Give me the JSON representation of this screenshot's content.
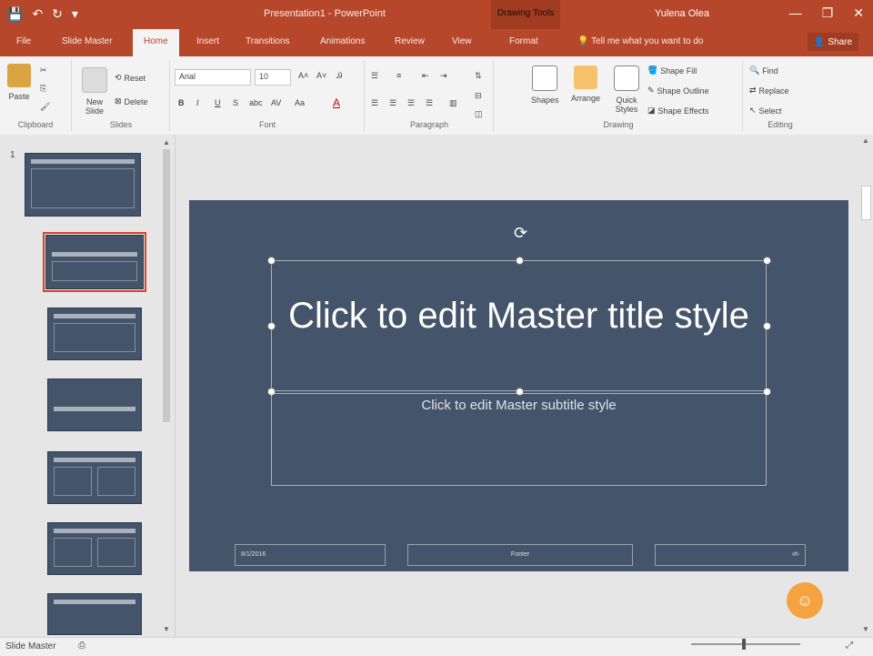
{
  "titlebar": {
    "doc_title": "Presentation1 - PowerPoint",
    "context_group": "Drawing Tools",
    "user": "Yulena Olea",
    "qat": {
      "save": "💾",
      "undo": "↶",
      "redo": "↻",
      "customize": "▾"
    },
    "window": {
      "minimize": "—",
      "restore": "❐",
      "close": "✕"
    }
  },
  "tabs": [
    {
      "label": "File"
    },
    {
      "label": "Slide Master"
    },
    {
      "label": "Home"
    },
    {
      "label": "Insert"
    },
    {
      "label": "Transitions"
    },
    {
      "label": "Animations"
    },
    {
      "label": "Review"
    },
    {
      "label": "View"
    },
    {
      "label": "Format"
    }
  ],
  "tellme": "Tell me what you want to do",
  "share": "Share",
  "ribbon": {
    "clipboard": {
      "paste": "Paste",
      "label": "Clipboard"
    },
    "slides": {
      "new": "New Slide",
      "reset": "Reset",
      "delete": "Delete",
      "label": "Slides"
    },
    "font": {
      "name": "Arial",
      "size": "10",
      "bold": "B",
      "italic": "I",
      "underline": "U",
      "strike": "S",
      "label": "Font"
    },
    "paragraph": {
      "label": "Paragraph"
    },
    "drawing": {
      "shapes": "Shapes",
      "arrange": "Arrange",
      "quick": "Quick Styles",
      "fill": "Shape Fill",
      "outline": "Shape Outline",
      "effects": "Shape Effects",
      "label": "Drawing"
    },
    "editing": {
      "find": "Find",
      "replace": "Replace",
      "select": "Select",
      "label": "Editing"
    }
  },
  "thumbnails": {
    "slide_number": "1"
  },
  "slide": {
    "title": "Click to edit Master title style",
    "subtitle": "Click to edit Master subtitle style",
    "footer_date": "8/1/2016",
    "footer_center": "Footer",
    "footer_right": "‹#›"
  },
  "status": {
    "mode": "Slide Master"
  },
  "colors": {
    "accent": "#b7472a",
    "slide_bg": "#44546a",
    "selection": "#d24726"
  }
}
